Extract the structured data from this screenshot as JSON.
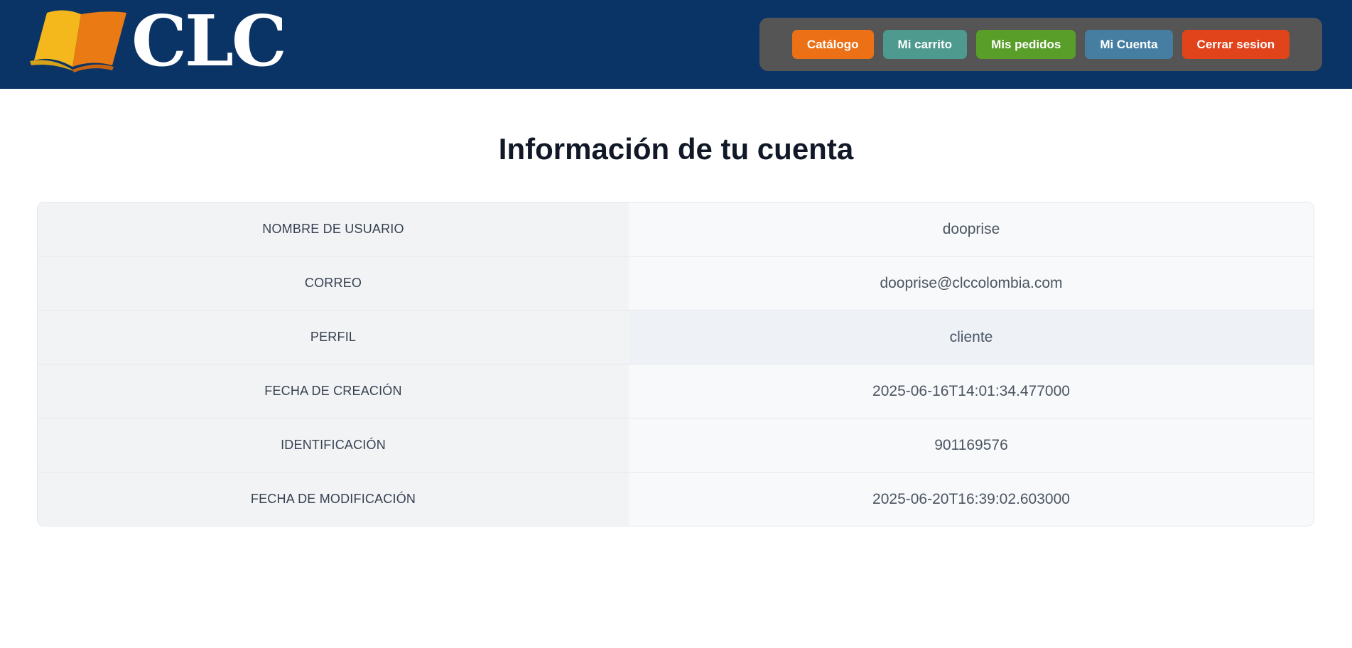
{
  "header": {
    "logo_text": "CLC",
    "logo_icon": "open-book-icon",
    "colors": {
      "background": "#0a3366",
      "nav_background": "#555555"
    }
  },
  "nav": {
    "buttons": [
      {
        "label": "Catálogo",
        "color": "#ec7016"
      },
      {
        "label": "Mi carrito",
        "color": "#4e9a8e"
      },
      {
        "label": "Mis pedidos",
        "color": "#5a9e2a"
      },
      {
        "label": "Mi Cuenta",
        "color": "#467ea2"
      },
      {
        "label": "Cerrar sesion",
        "color": "#e1431b"
      }
    ]
  },
  "main": {
    "title": "Información de tu cuenta",
    "rows": [
      {
        "label": "NOMBRE DE USUARIO",
        "value": "dooprise"
      },
      {
        "label": "CORREO",
        "value": "dooprise@clccolombia.com"
      },
      {
        "label": "PERFIL",
        "value": "cliente"
      },
      {
        "label": "FECHA DE CREACIÓN",
        "value": "2025-06-16T14:01:34.477000"
      },
      {
        "label": "IDENTIFICACIÓN",
        "value": "901169576"
      },
      {
        "label": "FECHA DE MODIFICACIÓN",
        "value": "2025-06-20T16:39:02.603000"
      }
    ]
  }
}
